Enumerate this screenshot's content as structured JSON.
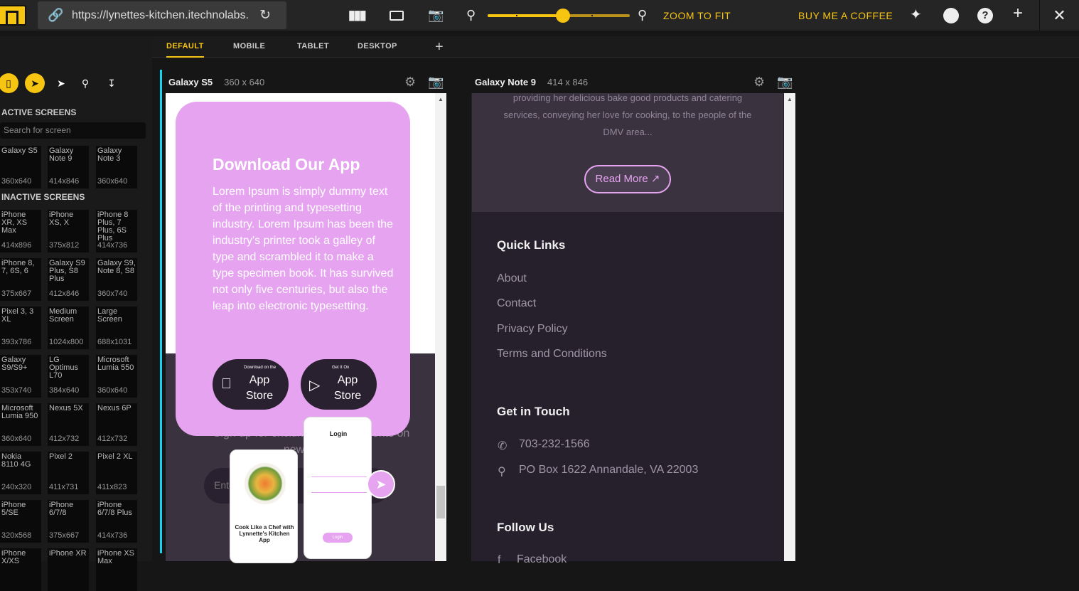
{
  "topbar": {
    "url": "https://lynettes-kitchen.itechnolabs.",
    "zoom_level": 0.53,
    "zoom_to_fit": "ZOOM TO FIT",
    "buy_coffee": "BUY ME A COFFEE"
  },
  "tabs": [
    "DEFAULT",
    "MOBILE",
    "TABLET",
    "DESKTOP"
  ],
  "sidebar": {
    "active_heading": "ACTIVE SCREENS",
    "search_placeholder": "Search for screen",
    "active_screens": [
      {
        "name": "Galaxy S5",
        "dims": "360x640"
      },
      {
        "name": "Galaxy Note 9",
        "dims": "414x846"
      },
      {
        "name": "Galaxy Note 3",
        "dims": "360x640"
      }
    ],
    "inactive_heading": "INACTIVE SCREENS",
    "inactive_screens": [
      {
        "name": "iPhone XR, XS Max",
        "dims": "414x896"
      },
      {
        "name": "iPhone XS, X",
        "dims": "375x812"
      },
      {
        "name": "iPhone 8 Plus, 7 Plus, 6S Plus",
        "dims": "414x736"
      },
      {
        "name": "iPhone 8, 7, 6S, 6",
        "dims": "375x667"
      },
      {
        "name": "Galaxy S9 Plus, S8 Plus",
        "dims": "412x846"
      },
      {
        "name": "Galaxy S9, Note 8, S8",
        "dims": "360x740"
      },
      {
        "name": "Pixel 3, 3 XL",
        "dims": "393x786"
      },
      {
        "name": "Medium Screen",
        "dims": "1024x800"
      },
      {
        "name": "Large Screen",
        "dims": "688x1031"
      },
      {
        "name": "Galaxy S9/S9+",
        "dims": "353x740"
      },
      {
        "name": "LG Optimus L70",
        "dims": "384x640"
      },
      {
        "name": "Microsoft Lumia 550",
        "dims": "360x640"
      },
      {
        "name": "Microsoft Lumia 950",
        "dims": "360x640"
      },
      {
        "name": "Nexus 5X",
        "dims": "412x732"
      },
      {
        "name": "Nexus 6P",
        "dims": "412x732"
      },
      {
        "name": "Nokia 8110 4G",
        "dims": "240x320"
      },
      {
        "name": "Pixel 2",
        "dims": "411x731"
      },
      {
        "name": "Pixel 2 XL",
        "dims": "411x823"
      },
      {
        "name": "iPhone 5/SE",
        "dims": "320x568"
      },
      {
        "name": "iPhone 6/7/8",
        "dims": "375x667"
      },
      {
        "name": "iPhone 6/7/8 Plus",
        "dims": "414x736"
      },
      {
        "name": "iPhone X/XS",
        "dims": ""
      },
      {
        "name": "iPhone XR",
        "dims": ""
      },
      {
        "name": "iPhone XS Max",
        "dims": ""
      }
    ]
  },
  "device1": {
    "name": "Galaxy S5",
    "dims": "360  x  640",
    "download_title": "Download Our App",
    "download_body": "Lorem Ipsum is simply dummy text of the printing and typesetting industry. Lorem Ipsum has been the industry's printer took a galley of type and scrambled it to make a type specimen book. It has survived not only five centuries, but also the leap into electronic typesetting.",
    "apple_small": "Download on the",
    "apple_big": "App Store",
    "play_small": "Get It On",
    "play_big": "App Store",
    "newsletter_text": "Sign up for exciting announcements on new treats!",
    "email_placeholder": "Ente",
    "phone_login_title": "Login",
    "phone_card_title": "Cook Like a Chef with Lynnette's Kitchen App",
    "phone_btn": "Login"
  },
  "device2": {
    "name": "Galaxy Note 9",
    "dims": "414  x  846",
    "about_text": "providing her delicious bake good products and catering services, conveying her love for cooking, to the people of the DMV area...",
    "read_more": "Read More",
    "quick_links_heading": "Quick Links",
    "quick_links": [
      "About",
      "Contact",
      "Privacy Policy",
      "Terms and Conditions"
    ],
    "get_in_touch_heading": "Get in Touch",
    "phone": "703-232-1566",
    "address": "PO Box 1622 Annandale, VA 22003",
    "follow_heading": "Follow Us",
    "facebook": "Facebook"
  },
  "colors": {
    "accent": "#f6c511",
    "pink": "#e6a3f0",
    "dark_purple": "#26202c",
    "cyan": "#14d2f0"
  }
}
